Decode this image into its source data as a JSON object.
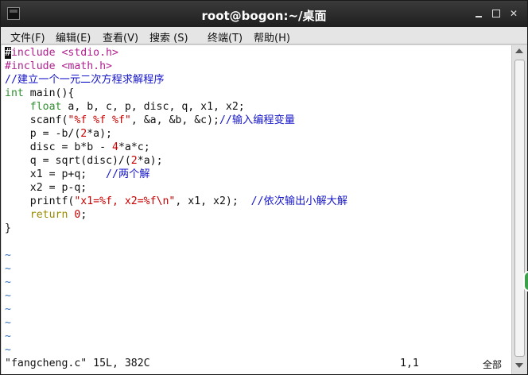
{
  "window": {
    "title": "root@bogon:~/桌面"
  },
  "menu": [
    {
      "label": "文件(F)"
    },
    {
      "label": "编辑(E)"
    },
    {
      "label": "查看(V)"
    },
    {
      "label": "搜索 (S)"
    },
    {
      "label": "终端(T)"
    },
    {
      "label": "帮助(H)"
    }
  ],
  "code": {
    "l1": {
      "cursor": "#",
      "rest": "include <stdio.h>"
    },
    "l2": "#include <math.h>",
    "l3": "//建立一个一元二次方程求解程序",
    "l4": {
      "kw": "int",
      "rest": " main(){"
    },
    "l5": {
      "indent": "    ",
      "kw": "float",
      "rest": " a, b, c, p, disc, q, x1, x2;"
    },
    "l6": {
      "pre": "    scanf(",
      "str": "\"%f %f %f\"",
      "mid": ", &a, &b, &c);",
      "cm": "//输入编程变量"
    },
    "l7": {
      "pre": "    p = -b/(",
      "num": "2",
      "post": "*a);"
    },
    "l8": {
      "pre": "    disc = b*b - ",
      "num": "4",
      "post": "*a*c;"
    },
    "l9": {
      "pre": "    q = sqrt(disc)/(",
      "num": "2",
      "post": "*a);"
    },
    "l10": {
      "pre": "    x1 = p+q;   ",
      "cm": "//两个解"
    },
    "l11": "    x2 = p-q;",
    "l12": {
      "pre": "    printf(",
      "str": "\"x1=%f, x2=%f\\n\"",
      "mid": ", x1, x2);  ",
      "cm": "//依次输出小解大解"
    },
    "l13": {
      "indent": "    ",
      "kw": "return",
      "sp": " ",
      "num": "0",
      "post": ";"
    },
    "l14": "}",
    "tilde": "~"
  },
  "status": {
    "file": "\"fangcheng.c\" 15L, 382C",
    "position": "1,1",
    "scroll": "全部"
  },
  "colors": {
    "preprocessor": "#b0208f",
    "string": "#c80000",
    "comment": "#1515c8",
    "type_keyword": "#2f8f2f",
    "statement_keyword": "#9a8a00",
    "tilde": "#3a6fb8"
  }
}
